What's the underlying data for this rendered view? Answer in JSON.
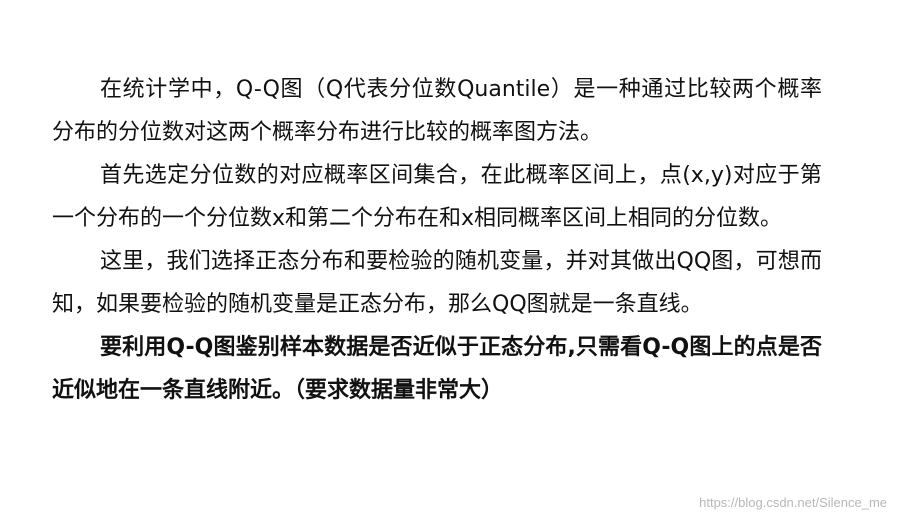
{
  "paragraphs": [
    {
      "text": "在统计学中，Q-Q图（Q代表分位数Quantile）是一种通过比较两个概率分布的分位数对这两个概率分布进行比较的概率图方法。"
    },
    {
      "text": "首先选定分位数的对应概率区间集合，在此概率区间上，点(x,y)对应于第一个分布的一个分位数x和第二个分布在和x相同概率区间上相同的分位数。"
    },
    {
      "text": "这里，我们选择正态分布和要检验的随机变量，并对其做出QQ图，可想而知，如果要检验的随机变量是正态分布，那么QQ图就是一条直线。"
    },
    {
      "text": "要利用Q-Q图鉴别样本数据是否近似于正态分布,只需看Q-Q图上的点是否近似地在一条直线附近。（要求数据量非常大）"
    }
  ],
  "watermark": "https://blog.csdn.net/Silence_me"
}
